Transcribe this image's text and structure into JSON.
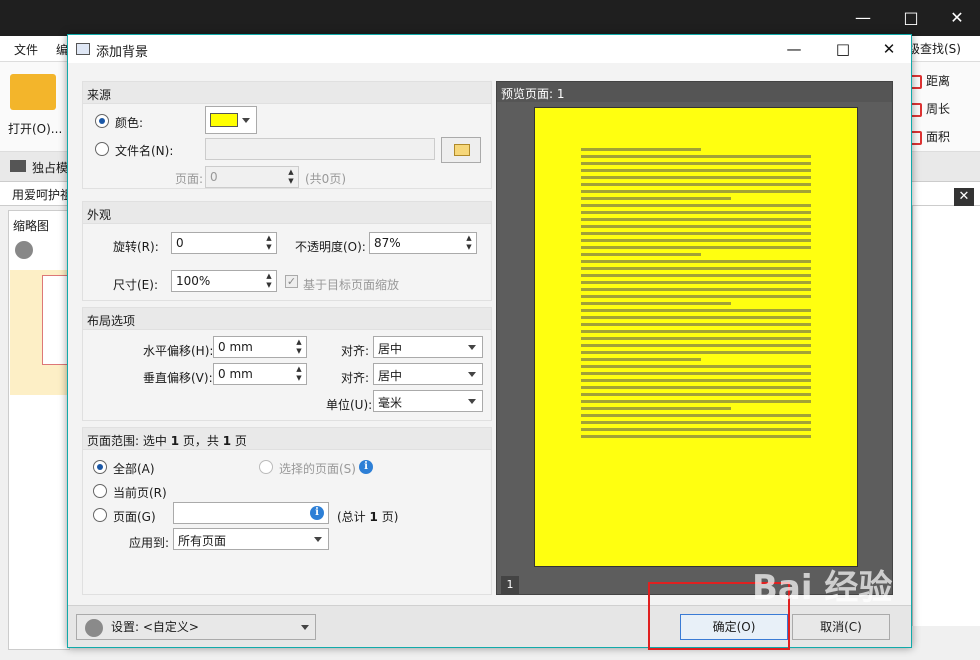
{
  "app": {
    "menu": [
      "文件",
      "编"
    ],
    "open_label": "打开(O)...",
    "exclusive_label": "独占模",
    "tab_label": "用爱呵护祖",
    "thumb_title": "缩略图",
    "ribbon_right": [
      "级查找(S)",
      "距离",
      "周长",
      "面积"
    ],
    "window_controls": [
      "—",
      "□",
      "✕"
    ]
  },
  "dialog": {
    "title": "添加背景",
    "controls": [
      "—",
      "□",
      "✕"
    ],
    "source": {
      "title": "来源",
      "color_label": "颜色:",
      "color_value": "#ffff00",
      "file_label": "文件名(N):",
      "page_label": "页面:",
      "page_value": "0",
      "page_total": "(共0页)"
    },
    "appearance": {
      "title": "外观",
      "rotation_label": "旋转(R):",
      "rotation_value": "0",
      "opacity_label": "不透明度(O):",
      "opacity_value": "87%",
      "size_label": "尺寸(E):",
      "size_value": "100%",
      "scale_label": "基于目标页面缩放"
    },
    "layout": {
      "title": "布局选项",
      "h_offset_label": "水平偏移(H):",
      "h_offset_value": "0 mm",
      "v_offset_label": "垂直偏移(V):",
      "v_offset_value": "0 mm",
      "align_label": "对齐:",
      "h_align_value": "居中",
      "v_align_value": "居中",
      "unit_label": "单位(U):",
      "unit_value": "毫米"
    },
    "range": {
      "title_prefix": "页面范围: 选中",
      "selected": "1",
      "title_mid": "页，共",
      "total": "1",
      "title_suffix": "页",
      "all_label": "全部(A)",
      "selected_pages_label": "选择的页面(S)",
      "current_label": "当前页(R)",
      "pages_label": "页面(G)",
      "pages_total_prefix": "(总计",
      "pages_total_value": "1",
      "pages_total_suffix": "页)",
      "apply_label": "应用到:",
      "apply_value": "所有页面"
    },
    "preview": {
      "title": "预览页面: 1",
      "page_number": "1"
    },
    "footer": {
      "settings_label": "设置:",
      "settings_value": "<自定义>",
      "ok_label": "确定(O)",
      "cancel_label": "取消(C)"
    }
  },
  "watermark": "Bai 经验"
}
